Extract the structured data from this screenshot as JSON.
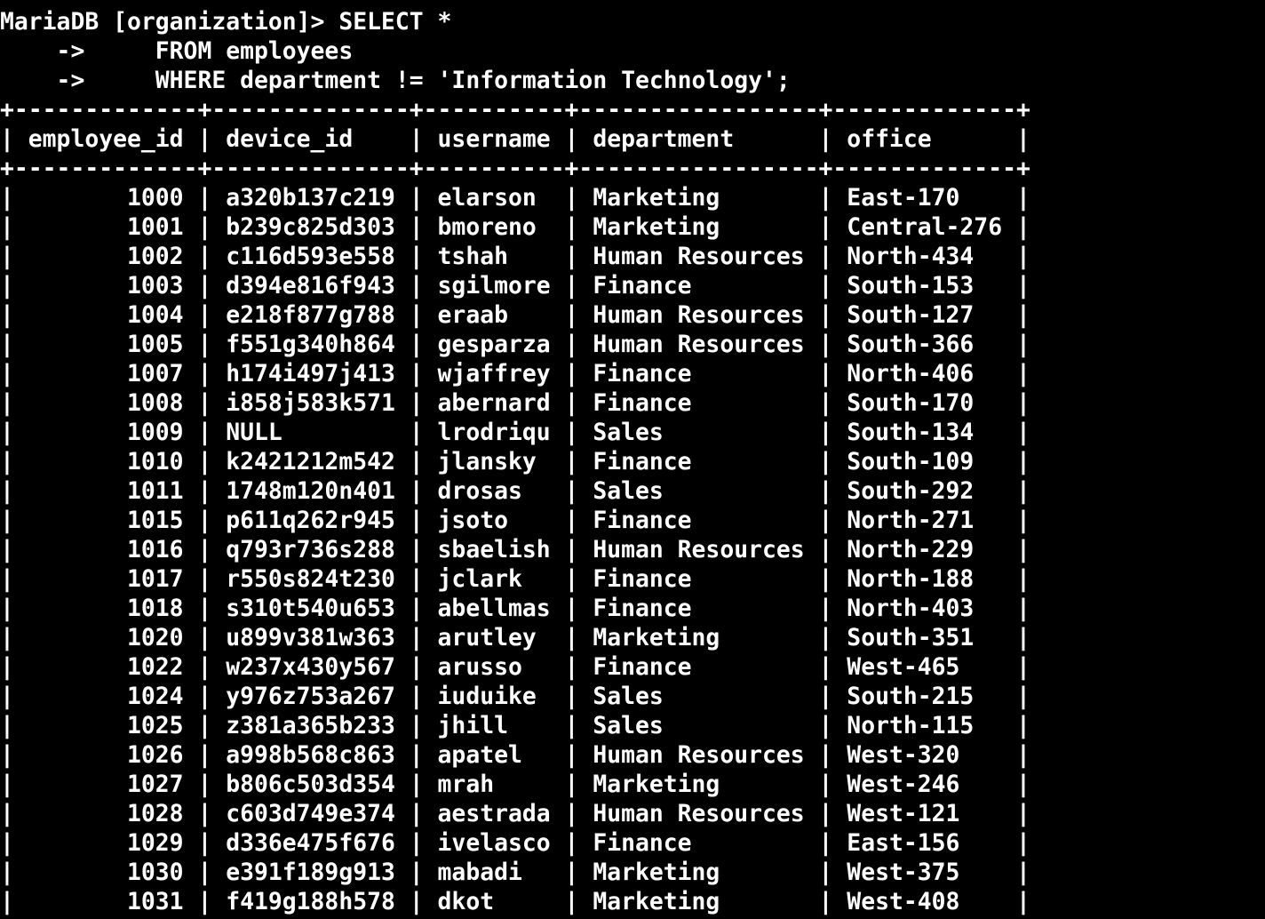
{
  "terminal": {
    "prompt": "MariaDB [organization]> ",
    "query_lines": [
      "SELECT *",
      "    ->     FROM employees",
      "    ->     WHERE department != 'Information Technology';"
    ],
    "columns": [
      "employee_id",
      "device_id",
      "username",
      "department",
      "office"
    ],
    "rows": [
      [
        "1000",
        "a320b137c219",
        "elarson",
        "Marketing",
        "East-170"
      ],
      [
        "1001",
        "b239c825d303",
        "bmoreno",
        "Marketing",
        "Central-276"
      ],
      [
        "1002",
        "c116d593e558",
        "tshah",
        "Human Resources",
        "North-434"
      ],
      [
        "1003",
        "d394e816f943",
        "sgilmore",
        "Finance",
        "South-153"
      ],
      [
        "1004",
        "e218f877g788",
        "eraab",
        "Human Resources",
        "South-127"
      ],
      [
        "1005",
        "f551g340h864",
        "gesparza",
        "Human Resources",
        "South-366"
      ],
      [
        "1007",
        "h174i497j413",
        "wjaffrey",
        "Finance",
        "North-406"
      ],
      [
        "1008",
        "i858j583k571",
        "abernard",
        "Finance",
        "South-170"
      ],
      [
        "1009",
        "NULL",
        "lrodriqu",
        "Sales",
        "South-134"
      ],
      [
        "1010",
        "k2421212m542",
        "jlansky",
        "Finance",
        "South-109"
      ],
      [
        "1011",
        "1748m120n401",
        "drosas",
        "Sales",
        "South-292"
      ],
      [
        "1015",
        "p611q262r945",
        "jsoto",
        "Finance",
        "North-271"
      ],
      [
        "1016",
        "q793r736s288",
        "sbaelish",
        "Human Resources",
        "North-229"
      ],
      [
        "1017",
        "r550s824t230",
        "jclark",
        "Finance",
        "North-188"
      ],
      [
        "1018",
        "s310t540u653",
        "abellmas",
        "Finance",
        "North-403"
      ],
      [
        "1020",
        "u899v381w363",
        "arutley",
        "Marketing",
        "South-351"
      ],
      [
        "1022",
        "w237x430y567",
        "arusso",
        "Finance",
        "West-465"
      ],
      [
        "1024",
        "y976z753a267",
        "iuduike",
        "Sales",
        "South-215"
      ],
      [
        "1025",
        "z381a365b233",
        "jhill",
        "Sales",
        "North-115"
      ],
      [
        "1026",
        "a998b568c863",
        "apatel",
        "Human Resources",
        "West-320"
      ],
      [
        "1027",
        "b806c503d354",
        "mrah",
        "Marketing",
        "West-246"
      ],
      [
        "1028",
        "c603d749e374",
        "aestrada",
        "Human Resources",
        "West-121"
      ],
      [
        "1029",
        "d336e475f676",
        "ivelasco",
        "Finance",
        "East-156"
      ],
      [
        "1030",
        "e391f189g913",
        "mabadi",
        "Marketing",
        "West-375"
      ],
      [
        "1031",
        "f419g188h578",
        "dkot",
        "Marketing",
        "West-408"
      ]
    ]
  },
  "colors": {
    "background": "#000000",
    "text": "#ffffff"
  }
}
